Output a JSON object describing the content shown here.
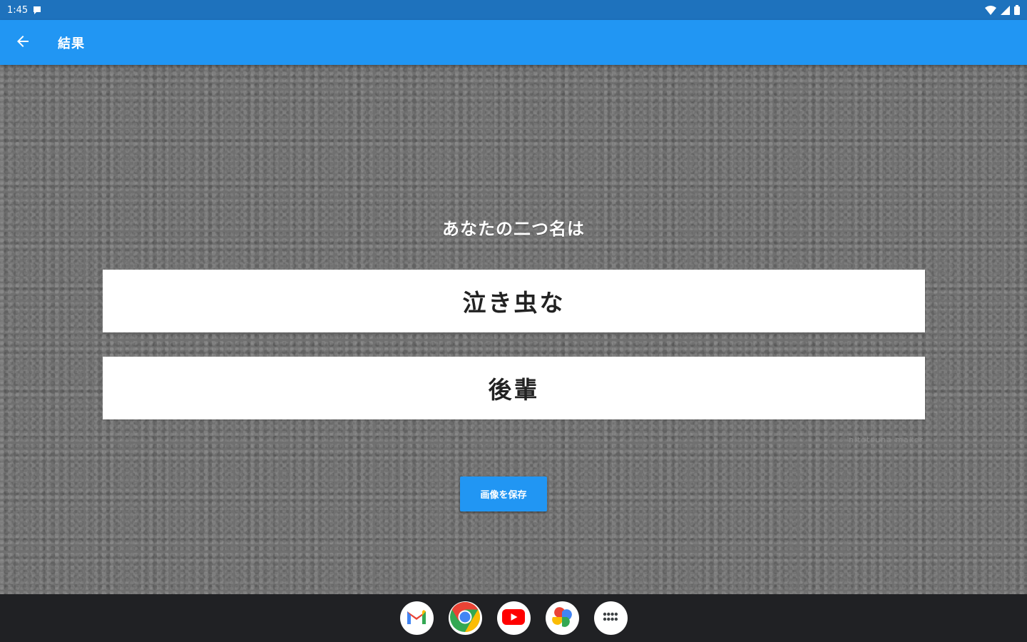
{
  "status_bar": {
    "time": "1:45",
    "icons": [
      "chat-bubble-icon",
      "wifi-icon",
      "signal-icon",
      "battery-icon"
    ]
  },
  "app_bar": {
    "title": "結果",
    "back_icon": "arrow-left-icon"
  },
  "content": {
    "prompt": "あなたの二つ名は",
    "name_parts": [
      "泣き虫な",
      "後輩"
    ],
    "watermark": "nitotsuna maker",
    "save_button_label": "画像を保存"
  },
  "taskbar": {
    "apps": [
      "gmail-icon",
      "chrome-icon",
      "youtube-icon",
      "photos-icon",
      "app-launcher-icon"
    ]
  },
  "colors": {
    "status_bar": "#1e72bd",
    "app_bar": "#2196f3",
    "background": "#707070",
    "taskbar": "#202124",
    "accent": "#2196f3"
  }
}
